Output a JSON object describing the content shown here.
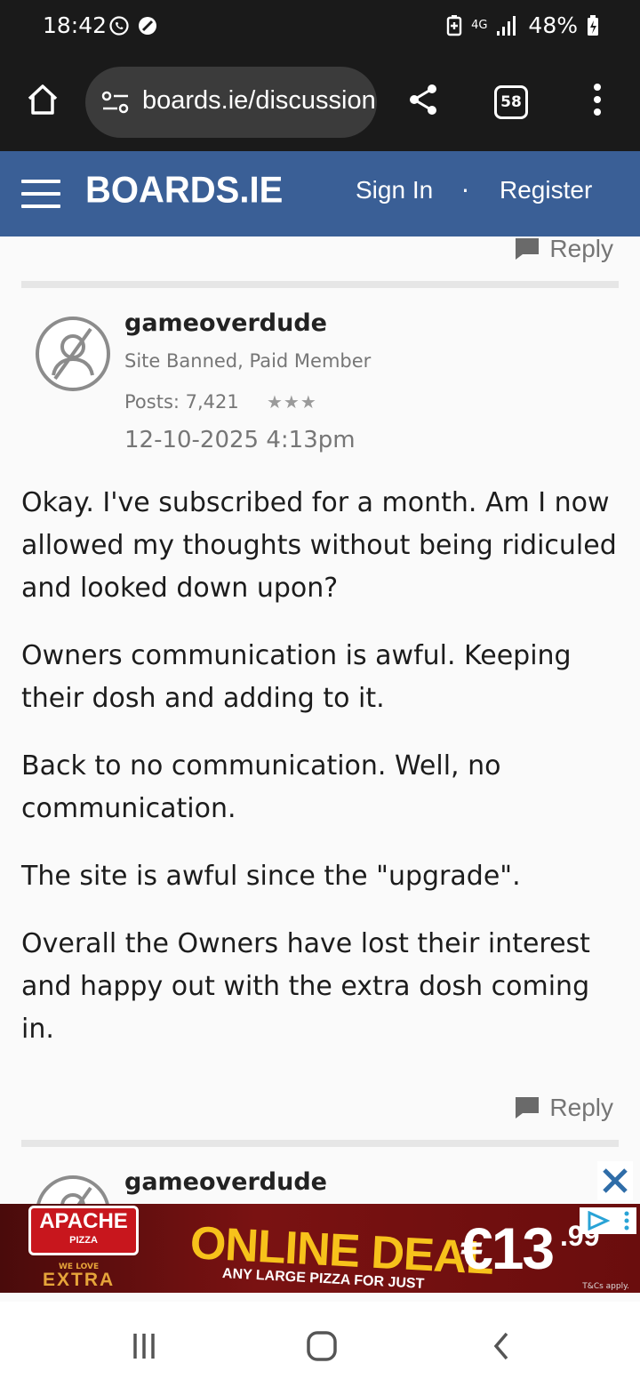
{
  "status_bar": {
    "time": "18:42",
    "network": "4G",
    "battery": "48%"
  },
  "browser": {
    "url": "boards.ie/discussion",
    "tab_count": "58"
  },
  "site_header": {
    "logo": "BOARDS.IE",
    "sign_in": "Sign In",
    "separator": "·",
    "register": "Register"
  },
  "reply_label": "Reply",
  "post": {
    "username": "gameoverdude",
    "role": "Site Banned, Paid Member",
    "posts": "Posts: 7,421",
    "rank_stars": "★★★",
    "date": "12-10-2025 4:13pm",
    "paragraphs": [
      "Okay. I've subscribed for a month. Am I now allowed my thoughts without being ridiculed and looked down upon?",
      "Owners communication is awful. Keeping their dosh and adding to it.",
      "Back to no communication. Well, no communication.",
      "The site is awful since the \"upgrade\".",
      "Overall the Owners have lost their interest and happy out with the extra dosh coming in."
    ]
  },
  "next_post": {
    "username": "gameoverdude"
  },
  "ad": {
    "brand": "APACHE",
    "brand_sub": "PIZZA",
    "tagline_small": "WE LOVE",
    "tagline": "EXTRA",
    "headline": "ONLINE DEAL",
    "subline": "ANY LARGE PIZZA FOR JUST",
    "price": "€13",
    "price_cents": ".99",
    "terms": "T&Cs apply.",
    "colors": {
      "bg": "#6a0d0d",
      "headline": "#f7c21b"
    }
  },
  "colors": {
    "header_bg": "#3a5f96",
    "browser_bg": "#1a1a1a",
    "muted_text": "#767676"
  }
}
